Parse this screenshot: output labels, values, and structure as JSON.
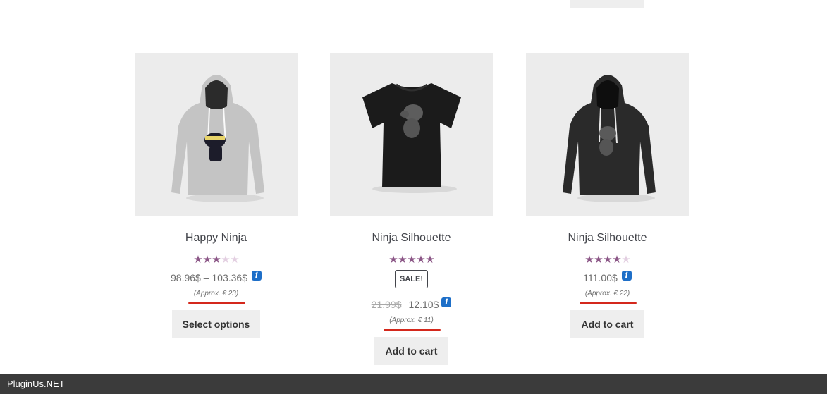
{
  "products": [
    {
      "title": "Happy Ninja",
      "rating": 3,
      "price": "98.96$ – 103.36$",
      "approx": "(Approx. € 23)",
      "button": "Select options",
      "image": "grey-hoodie"
    },
    {
      "title": "Ninja Silhouette",
      "rating": 5,
      "sale_badge": "SALE!",
      "old_price": "21.99$",
      "price": "12.10$",
      "approx": "(Approx. € 11)",
      "button": "Add to cart",
      "image": "black-tshirt"
    },
    {
      "title": "Ninja Silhouette",
      "rating": 4,
      "price": "111.00$",
      "approx": "(Approx. € 22)",
      "button": "Add to cart",
      "image": "black-hoodie"
    }
  ],
  "info_icon_glyph": "i",
  "footer": {
    "text": "PluginUs.NET"
  },
  "colors": {
    "star": "#8c5787",
    "star_empty": "#e3cfe1",
    "underline": "#d4281c",
    "info": "#1e6fc8"
  }
}
